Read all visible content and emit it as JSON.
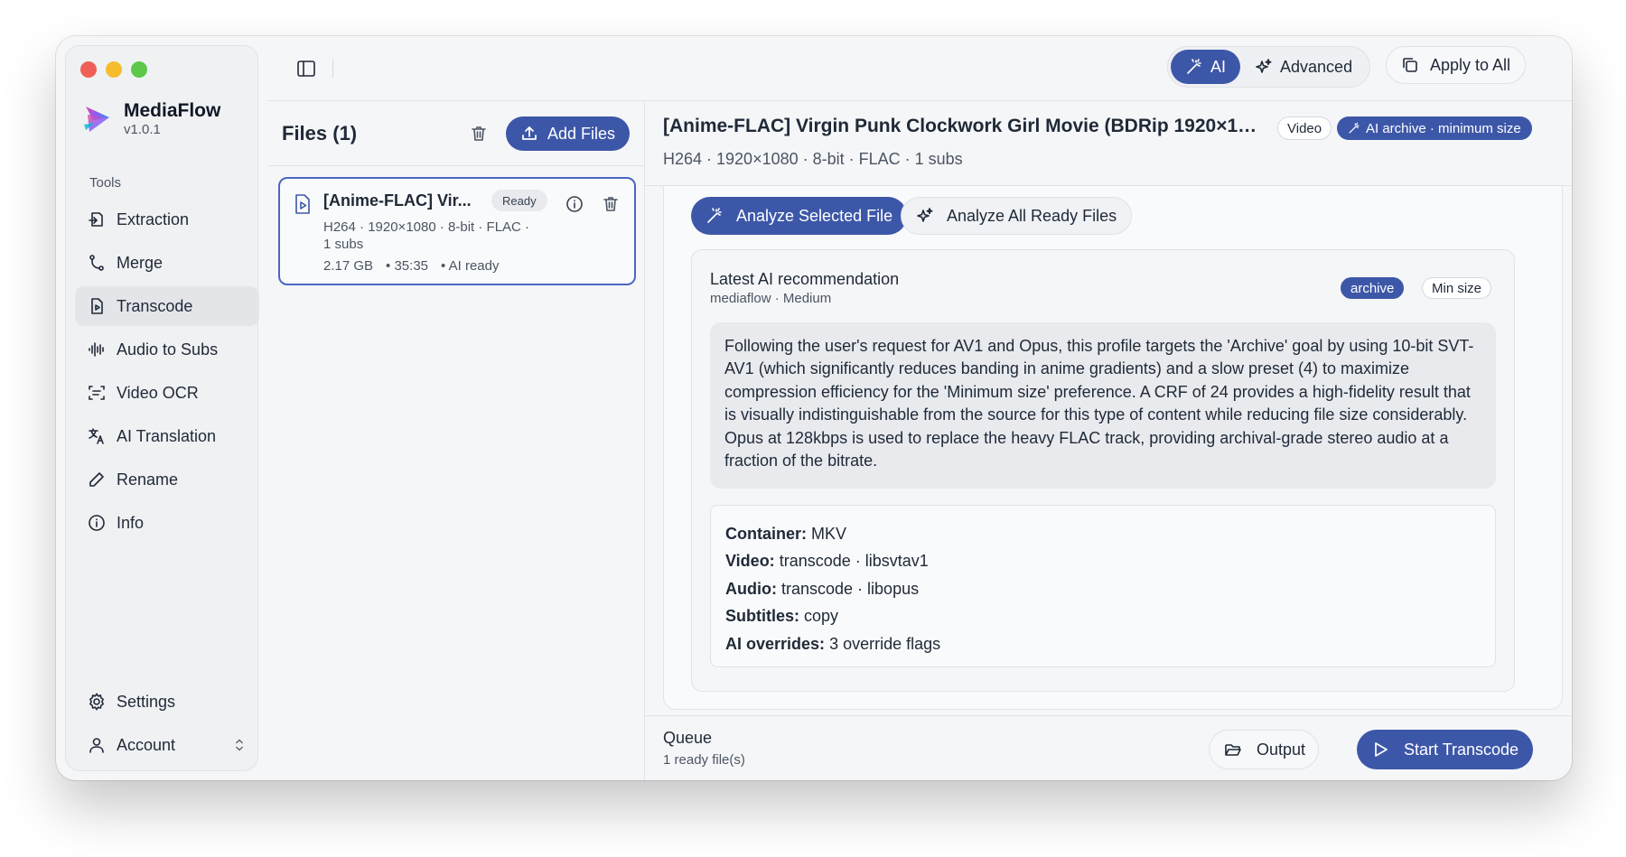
{
  "app": {
    "name": "MediaFlow",
    "version": "v1.0.1"
  },
  "sidebar": {
    "section_label": "Tools",
    "items": [
      {
        "label": "Extraction",
        "icon": "extraction-icon"
      },
      {
        "label": "Merge",
        "icon": "merge-icon"
      },
      {
        "label": "Transcode",
        "icon": "transcode-icon",
        "active": true
      },
      {
        "label": "Audio to Subs",
        "icon": "audio-waveform-icon"
      },
      {
        "label": "Video OCR",
        "icon": "ocr-scan-icon"
      },
      {
        "label": "AI Translation",
        "icon": "translate-icon"
      },
      {
        "label": "Rename",
        "icon": "pencil-icon"
      },
      {
        "label": "Info",
        "icon": "info-icon"
      }
    ],
    "settings_label": "Settings",
    "account_label": "Account"
  },
  "toolbar": {
    "ai_label": "AI",
    "advanced_label": "Advanced",
    "apply_all_label": "Apply to All",
    "mode_active": "AI"
  },
  "files": {
    "title": "Files (1)",
    "add_label": "Add Files",
    "items": [
      {
        "name": "[Anime-FLAC] Vir...",
        "status": "Ready",
        "meta": "H264 · 1920×1080 · 8-bit · FLAC · 1 subs",
        "size": "2.17 GB",
        "duration": "• 35:35",
        "ai_status": "• AI ready"
      }
    ]
  },
  "detail": {
    "title": "[Anime-FLAC] Virgin Punk Clockwork Girl Movie (BDRip 1920×10...",
    "type_badge": "Video",
    "ai_badge": "AI archive · minimum size",
    "subtitle": "H264 · 1920×1080 · 8-bit · FLAC · 1 subs",
    "analyze_selected_label": "Analyze Selected File",
    "analyze_all_label": "Analyze All Ready Files",
    "recommendation": {
      "title": "Latest AI recommendation",
      "source": "mediaflow · Medium",
      "goal_badge": "archive",
      "preference_badge": "Min size",
      "text": "Following the user's request for AV1 and Opus, this profile targets the 'Archive' goal by using 10-bit SVT-AV1 (which significantly reduces banding in anime gradients) and a slow preset (4) to maximize compression efficiency for the 'Minimum size' preference. A CRF of 24 provides a high-fidelity result that is visually indistinguishable from the source for this type of content while reducing file size considerably. Opus at 128kbps is used to replace the heavy FLAC track, providing archival-grade stereo audio at a fraction of the bitrate.",
      "settings": [
        {
          "key": "Container:",
          "value": "MKV"
        },
        {
          "key": "Video:",
          "value": "transcode · libsvtav1"
        },
        {
          "key": "Audio:",
          "value": "transcode · libopus"
        },
        {
          "key": "Subtitles:",
          "value": "copy"
        },
        {
          "key": "AI overrides:",
          "value": "3 override flags"
        }
      ]
    }
  },
  "queue": {
    "title": "Queue",
    "status": "1 ready file(s)",
    "output_label": "Output",
    "start_label": "Start Transcode"
  },
  "colors": {
    "accent": "#3d57a8",
    "window_bg": "#f5f6f8",
    "sidebar_bg": "#f0f1f3",
    "traffic_red": "#ee5f57",
    "traffic_yellow": "#f5bd2e",
    "traffic_green": "#5dc84a"
  }
}
